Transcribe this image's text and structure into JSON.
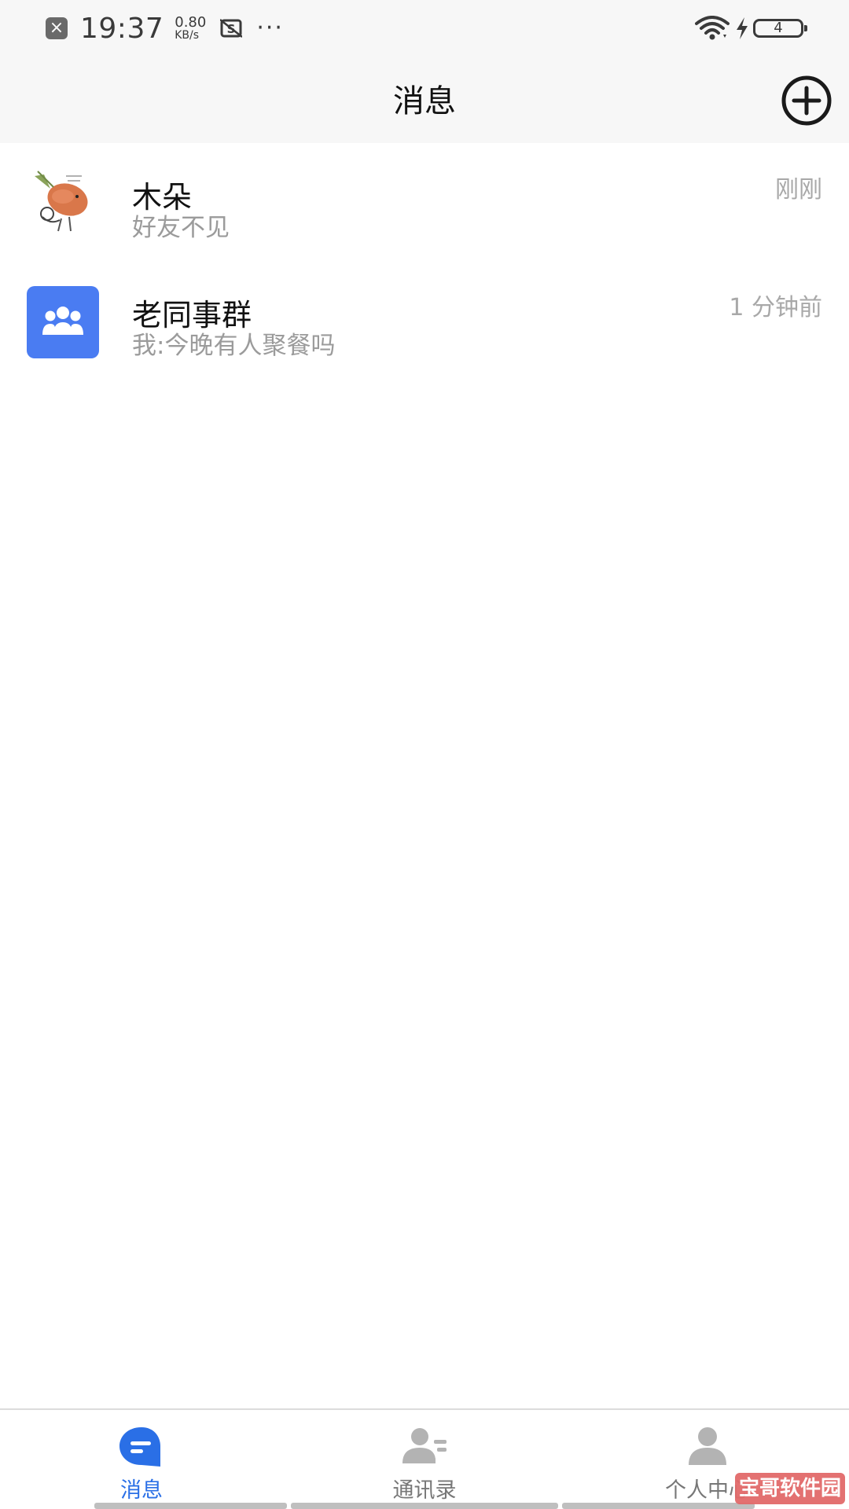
{
  "status_bar": {
    "time": "19:37",
    "net_speed_value": "0.80",
    "net_speed_unit": "KB/s",
    "more": "···",
    "battery_level": "4",
    "icons": [
      "notification-close-icon",
      "screenshot-app-icon",
      "wifi-icon",
      "charging-icon",
      "battery-icon"
    ]
  },
  "header": {
    "title": "消息",
    "add_icon": "plus-circle-icon"
  },
  "chats": [
    {
      "name": "木朵",
      "preview": "好友不见",
      "time": "刚刚",
      "avatar": "photo-avatar"
    },
    {
      "name": "老同事群",
      "preview": "我:今晚有人聚餐吗",
      "time": "1 分钟前",
      "avatar": "group-avatar-icon"
    }
  ],
  "bottom_nav": [
    {
      "label": "消息",
      "icon": "message-bubble-icon",
      "active": true
    },
    {
      "label": "通讯录",
      "icon": "contacts-icon",
      "active": false
    },
    {
      "label": "个人中心",
      "icon": "profile-icon",
      "active": false
    }
  ],
  "watermark": "宝哥软件园",
  "colors": {
    "accent": "#2a6fe6",
    "group_avatar_bg": "#4a7cf2",
    "header_bg": "#f7f7f7",
    "secondary_text": "#9b9b9b"
  }
}
